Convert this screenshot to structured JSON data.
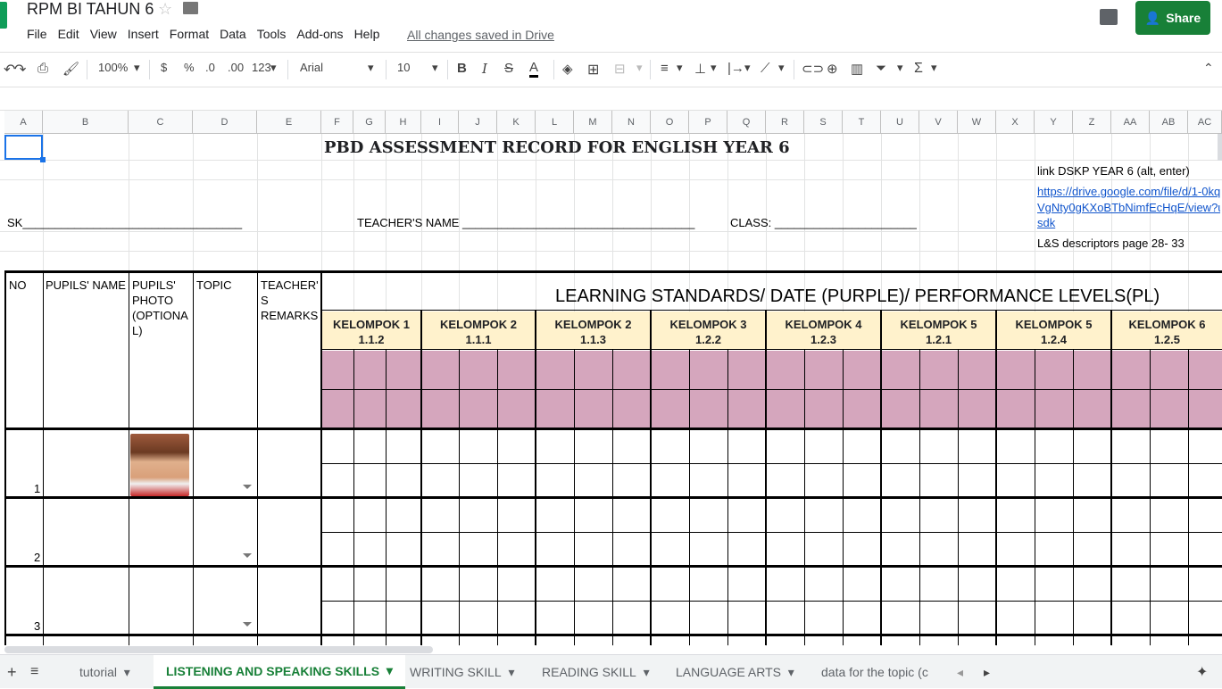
{
  "doc": {
    "title": "RPM BI TAHUN 6",
    "saved_status": "All changes saved in Drive"
  },
  "menu": [
    "File",
    "Edit",
    "View",
    "Insert",
    "Format",
    "Data",
    "Tools",
    "Add-ons",
    "Help"
  ],
  "share_label": "Share",
  "toolbar": {
    "zoom": "100%",
    "currency": "$",
    "percent": "%",
    "dec_less": ".0",
    "dec_more": ".00",
    "format": "123",
    "font": "Arial",
    "size": "10"
  },
  "columns": [
    "A",
    "B",
    "C",
    "D",
    "E",
    "F",
    "G",
    "H",
    "I",
    "J",
    "K",
    "L",
    "M",
    "N",
    "O",
    "P",
    "Q",
    "R",
    "S",
    "T",
    "U",
    "V",
    "W",
    "X",
    "Y",
    "Z",
    "AA",
    "AB",
    "AC"
  ],
  "sheet": {
    "title": "PBD ASSESSMENT RECORD FOR ENGLISH YEAR 6",
    "dskp_label": "link DSKP YEAR 6 (alt, enter)",
    "dskp_link": [
      "https://drive.google.com/file/d/1-0kq",
      "VgNty0gKXoBTbNimfEcHqE/view?u",
      "sdk"
    ],
    "ls_desc": "L&S descriptors page 28- 33",
    "sk": "SK__________________________________",
    "teacher": "TEACHER'S NAME ____________________________________",
    "class": "CLASS: ______________________",
    "hdr_no": "NO",
    "hdr_name": "PUPILS' NAME",
    "hdr_photo": [
      "PUPILS'",
      "PHOTO",
      "(OPTIONA",
      "L)"
    ],
    "hdr_topic": "TOPIC",
    "hdr_remarks": [
      "TEACHER'",
      "S",
      "REMARKS"
    ],
    "learning_standards": "LEARNING STANDARDS/ DATE (PURPLE)/ PERFORMANCE LEVELS(PL)",
    "groups": [
      {
        "name": "KELOMPOK 1",
        "code": "1.1.2"
      },
      {
        "name": "KELOMPOK 2",
        "code": "1.1.1"
      },
      {
        "name": "KELOMPOK 2",
        "code": "1.1.3"
      },
      {
        "name": "KELOMPOK 3",
        "code": "1.2.2"
      },
      {
        "name": "KELOMPOK 4",
        "code": "1.2.3"
      },
      {
        "name": "KELOMPOK 5",
        "code": "1.2.1"
      },
      {
        "name": "KELOMPOK 5",
        "code": "1.2.4"
      },
      {
        "name": "KELOMPOK 6",
        "code": "1.2.5"
      }
    ],
    "row_numbers": [
      "1",
      "2",
      "3"
    ]
  },
  "tabs": [
    "tutorial",
    "LISTENING AND SPEAKING SKILLS",
    "WRITING SKILL",
    "READING SKILL",
    "LANGUAGE ARTS",
    "data for the topic (c"
  ],
  "colors": {
    "share": "#188038",
    "header_fill": "#fff2cc",
    "date_fill": "#d5a6bd",
    "link": "#1155cc"
  }
}
